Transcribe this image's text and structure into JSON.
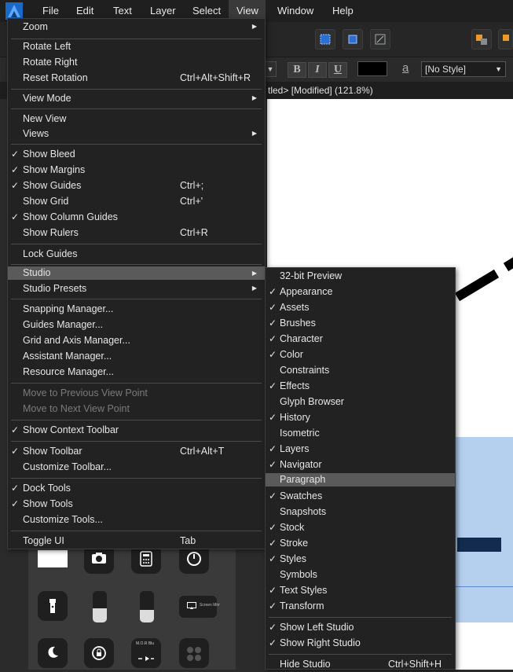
{
  "menubar": {
    "items": [
      {
        "label": "File"
      },
      {
        "label": "Edit"
      },
      {
        "label": "Text"
      },
      {
        "label": "Layer"
      },
      {
        "label": "Select"
      },
      {
        "label": "View"
      },
      {
        "label": "Window"
      },
      {
        "label": "Help"
      }
    ],
    "active": "View"
  },
  "context_toolbar": {
    "bold": "B",
    "italic": "I",
    "underline": "U",
    "char_icon": "a",
    "text_style": "[No Style]",
    "fill_color": "#000000"
  },
  "document": {
    "title": "tled> [Modified] (121.8%)"
  },
  "view_menu": {
    "items": [
      {
        "label": "Zoom",
        "submenu": true
      },
      {
        "label": "Rotate Left"
      },
      {
        "label": "Rotate Right"
      },
      {
        "label": "Reset Rotation",
        "shortcut": "Ctrl+Alt+Shift+R"
      },
      {
        "label": "View Mode",
        "submenu": true
      },
      {
        "label": "New View"
      },
      {
        "label": "Views",
        "submenu": true
      },
      {
        "label": "Show Bleed",
        "checked": true
      },
      {
        "label": "Show Margins",
        "checked": true
      },
      {
        "label": "Show Guides",
        "checked": true,
        "shortcut": "Ctrl+;"
      },
      {
        "label": "Show Grid",
        "shortcut": "Ctrl+'"
      },
      {
        "label": "Show Column Guides",
        "checked": true
      },
      {
        "label": "Show Rulers",
        "shortcut": "Ctrl+R"
      },
      {
        "label": "Lock Guides"
      },
      {
        "label": "Studio",
        "submenu": true,
        "highlighted": true
      },
      {
        "label": "Studio Presets",
        "submenu": true
      },
      {
        "label": "Snapping Manager..."
      },
      {
        "label": "Guides Manager..."
      },
      {
        "label": "Grid and Axis Manager..."
      },
      {
        "label": "Assistant Manager..."
      },
      {
        "label": "Resource Manager..."
      },
      {
        "label": "Move to Previous View Point",
        "disabled": true
      },
      {
        "label": "Move to Next View Point",
        "disabled": true
      },
      {
        "label": "Show Context Toolbar",
        "checked": true
      },
      {
        "label": "Show Toolbar",
        "checked": true,
        "shortcut": "Ctrl+Alt+T"
      },
      {
        "label": "Customize Toolbar..."
      },
      {
        "label": "Dock Tools",
        "checked": true
      },
      {
        "label": "Show Tools",
        "checked": true
      },
      {
        "label": "Customize Tools..."
      },
      {
        "label": "Toggle UI",
        "shortcut": "Tab"
      }
    ]
  },
  "studio_menu": {
    "items": [
      {
        "label": "32-bit Preview"
      },
      {
        "label": "Appearance",
        "checked": true
      },
      {
        "label": "Assets",
        "checked": true
      },
      {
        "label": "Brushes",
        "checked": true
      },
      {
        "label": "Character",
        "checked": true
      },
      {
        "label": "Color",
        "checked": true
      },
      {
        "label": "Constraints"
      },
      {
        "label": "Effects",
        "checked": true
      },
      {
        "label": "Glyph Browser"
      },
      {
        "label": "History",
        "checked": true
      },
      {
        "label": "Isometric"
      },
      {
        "label": "Layers",
        "checked": true
      },
      {
        "label": "Navigator",
        "checked": true
      },
      {
        "label": "Paragraph",
        "highlighted": true
      },
      {
        "label": "Swatches",
        "checked": true
      },
      {
        "label": "Snapshots"
      },
      {
        "label": "Stock",
        "checked": true
      },
      {
        "label": "Stroke",
        "checked": true
      },
      {
        "label": "Styles",
        "checked": true
      },
      {
        "label": "Symbols"
      },
      {
        "label": "Text Styles",
        "checked": true
      },
      {
        "label": "Transform",
        "checked": true
      },
      {
        "label": "Show Left Studio",
        "checked": true
      },
      {
        "label": "Show Right Studio",
        "checked": true
      },
      {
        "label": "Hide Studio",
        "shortcut": "Ctrl+Shift+H"
      }
    ]
  },
  "icon_panel": {
    "screen_mirror_label": "Screen Mirr",
    "media_label": "M.O.R Blu",
    "slider_levels": [
      0.45,
      0.4
    ]
  },
  "symbols": {
    "check": "✓",
    "submenu_arrow": "▶",
    "dropdown_arrow": "▼"
  },
  "colors": {
    "menu_bg": "#222222",
    "highlight": "#5a5a5a",
    "canvas": "#ffffff",
    "frame_blue": "#b5cfee"
  }
}
